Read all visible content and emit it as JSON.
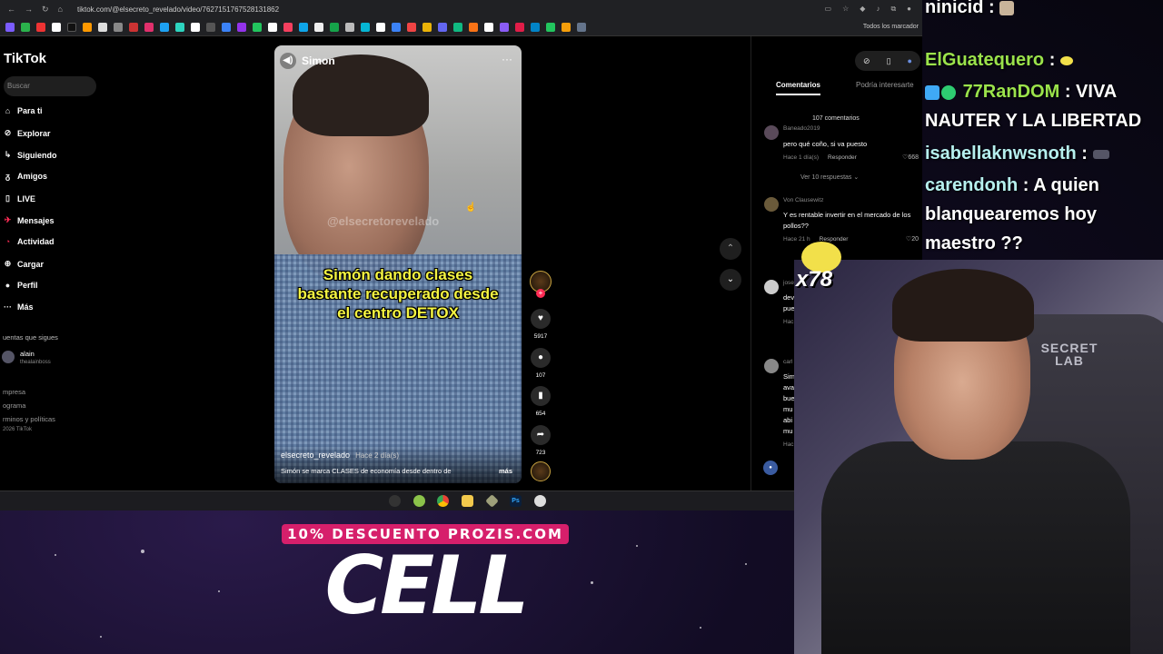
{
  "browser": {
    "url": "tiktok.com/@elsecreto_revelado/video/7627151767528131862",
    "all_bookmarks": "Todos los marcador",
    "nav_back": "←",
    "nav_forward": "→",
    "nav_reload": "↻",
    "nav_home": "⌂"
  },
  "tiktok": {
    "logo": "TikTok",
    "search_placeholder": "Buscar",
    "nav": [
      {
        "label": "Para ti",
        "icon": "home-icon"
      },
      {
        "label": "Explorar",
        "icon": "compass-icon"
      },
      {
        "label": "Siguiendo",
        "icon": "following-icon"
      },
      {
        "label": "Amigos",
        "icon": "friends-icon"
      },
      {
        "label": "LIVE",
        "icon": "live-icon"
      },
      {
        "label": "Mensajes",
        "icon": "messages-icon"
      },
      {
        "label": "Actividad",
        "icon": "activity-icon"
      },
      {
        "label": "Cargar",
        "icon": "upload-icon"
      },
      {
        "label": "Perfil",
        "icon": "profile-icon"
      },
      {
        "label": "Más",
        "icon": "more-icon"
      }
    ],
    "following_header": "uentas que sigues",
    "following_user": {
      "name": "alain",
      "handle": "thealainboss"
    },
    "footer": [
      "mpresa",
      "ograma",
      "rminos y políticas",
      "2026 TikTok"
    ]
  },
  "video": {
    "author_top": "Simon",
    "watermark": "@elsecretorevelado",
    "caption": "Simón dando clases bastante recuperado desde el centro DETOX",
    "handle": "elsecreto_revelado",
    "posted": "Hace 2 día(s)",
    "description": "Simón se marca CLASES de economía desde dentro de",
    "more": "más",
    "likes": "5917",
    "comments": "107",
    "saves": "654",
    "shares": "723"
  },
  "comments_panel": {
    "tab_comments": "Comentarios",
    "tab_related": "Podría interesarte",
    "count": "107 comentarios",
    "items": [
      {
        "user": "Baneado2019",
        "text": "pero qué coño, si va puesto",
        "time": "Hace 1 día(s)",
        "reply": "Responder",
        "likes": "668",
        "replies": "Ver 10 respuestas"
      },
      {
        "user": "Von Clausewitz",
        "text": "Y es rentable invertir en el mercado de los pollos??",
        "time": "Hace 21 h",
        "reply": "Responder",
        "likes": "20"
      },
      {
        "user": "jose",
        "text": "dev pue",
        "time": "Hac"
      },
      {
        "user": "carl",
        "text": "Sim ava bue mu abi mu",
        "time": "Hac"
      }
    ]
  },
  "chat": [
    {
      "user": "ninicid",
      "msg": "",
      "color": "#ffffff"
    },
    {
      "user": "ElGuatequero",
      "msg": "",
      "color": "#9be34b"
    },
    {
      "user": "77RanDOM",
      "msg": "VIVA NAUTER Y LA LIBERTAD",
      "color": "#9be34b"
    },
    {
      "user": "isabellaknwsnoth",
      "msg": "",
      "color": "#b6f0ee"
    },
    {
      "user": "carendonh",
      "msg": "A quien blanquearemos hoy maestro ??",
      "color": "#b6f0ee"
    }
  ],
  "webcam": {
    "chair_brand": "SECRET LAB"
  },
  "sponsor": {
    "promo": "10% DESCUENTO PROZIS.COM",
    "product": "CELL"
  },
  "combo": "x78",
  "colors": {
    "accent": "#fe2c55",
    "promo": "#d61f6b",
    "caption": "#f5f542"
  }
}
